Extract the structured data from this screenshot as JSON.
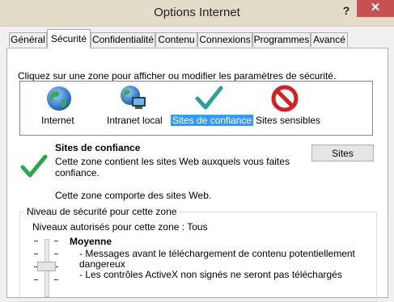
{
  "window": {
    "title": "Options Internet",
    "help_label": "?",
    "close_label": "✕"
  },
  "tabs": [
    {
      "label": "Général",
      "active": false
    },
    {
      "label": "Sécurité",
      "active": true
    },
    {
      "label": "Confidentialité",
      "active": false
    },
    {
      "label": "Contenu",
      "active": false
    },
    {
      "label": "Connexions",
      "active": false
    },
    {
      "label": "Programmes",
      "active": false
    },
    {
      "label": "Avancé",
      "active": false
    }
  ],
  "security": {
    "instruction": "Cliquez sur une zone pour afficher ou modifier les paramètres de sécurité.",
    "zones": [
      {
        "label": "Internet",
        "icon": "globe-icon"
      },
      {
        "label": "Intranet local",
        "icon": "globe-computer-icon"
      },
      {
        "label": "Sites de confiance",
        "icon": "checkmark-icon",
        "selected": true
      },
      {
        "label": "Sites sensibles",
        "icon": "restricted-icon"
      }
    ],
    "selected_zone": {
      "title": "Sites de confiance",
      "desc_line1": "Cette zone contient les sites Web auxquels vous faites",
      "desc_line2": "confiance.",
      "note": "Cette zone comporte des sites Web.",
      "sites_button": "Sites"
    },
    "level_group": {
      "label": "Niveau de sécurité pour cette zone",
      "allowed": "Niveaux autorisés pour cette zone : Tous",
      "level_name": "Moyenne",
      "desc": [
        "- Messages avant le téléchargement de contenu potentiellement",
        "dangereux",
        "- Les contrôles ActiveX non signés ne seront pas téléchargés"
      ]
    }
  },
  "colors": {
    "selection": "#3399ff",
    "close_button": "#c75050",
    "titlebar": "#e3dcc8",
    "check_green": "#2aa84a"
  }
}
